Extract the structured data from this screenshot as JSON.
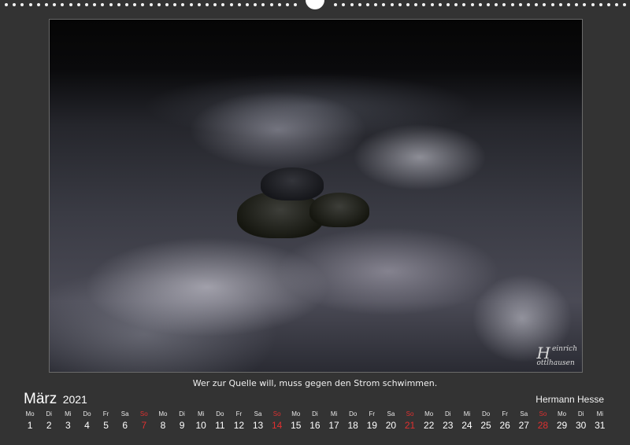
{
  "calendar": {
    "month": "März",
    "year": "2021",
    "quote": "Wer zur Quelle will, muss gegen den Strom schwimmen.",
    "author": "Hermann Hesse",
    "photo_signature_initial": "H",
    "photo_signature_line1": "einrich",
    "photo_signature_line2": "ottlhausen",
    "accent_color": "#e03030",
    "days": [
      {
        "wd": "Mo",
        "num": "1"
      },
      {
        "wd": "Di",
        "num": "2"
      },
      {
        "wd": "Mi",
        "num": "3"
      },
      {
        "wd": "Do",
        "num": "4"
      },
      {
        "wd": "Fr",
        "num": "5"
      },
      {
        "wd": "Sa",
        "num": "6"
      },
      {
        "wd": "So",
        "num": "7"
      },
      {
        "wd": "Mo",
        "num": "8"
      },
      {
        "wd": "Di",
        "num": "9"
      },
      {
        "wd": "Mi",
        "num": "10"
      },
      {
        "wd": "Do",
        "num": "11"
      },
      {
        "wd": "Fr",
        "num": "12"
      },
      {
        "wd": "Sa",
        "num": "13"
      },
      {
        "wd": "So",
        "num": "14"
      },
      {
        "wd": "Mo",
        "num": "15"
      },
      {
        "wd": "Di",
        "num": "16"
      },
      {
        "wd": "Mi",
        "num": "17"
      },
      {
        "wd": "Do",
        "num": "18"
      },
      {
        "wd": "Fr",
        "num": "19"
      },
      {
        "wd": "Sa",
        "num": "20"
      },
      {
        "wd": "So",
        "num": "21"
      },
      {
        "wd": "Mo",
        "num": "22"
      },
      {
        "wd": "Di",
        "num": "23"
      },
      {
        "wd": "Mi",
        "num": "24"
      },
      {
        "wd": "Do",
        "num": "25"
      },
      {
        "wd": "Fr",
        "num": "26"
      },
      {
        "wd": "Sa",
        "num": "27"
      },
      {
        "wd": "So",
        "num": "28"
      },
      {
        "wd": "Mo",
        "num": "29"
      },
      {
        "wd": "Di",
        "num": "30"
      },
      {
        "wd": "Mi",
        "num": "31"
      }
    ]
  }
}
